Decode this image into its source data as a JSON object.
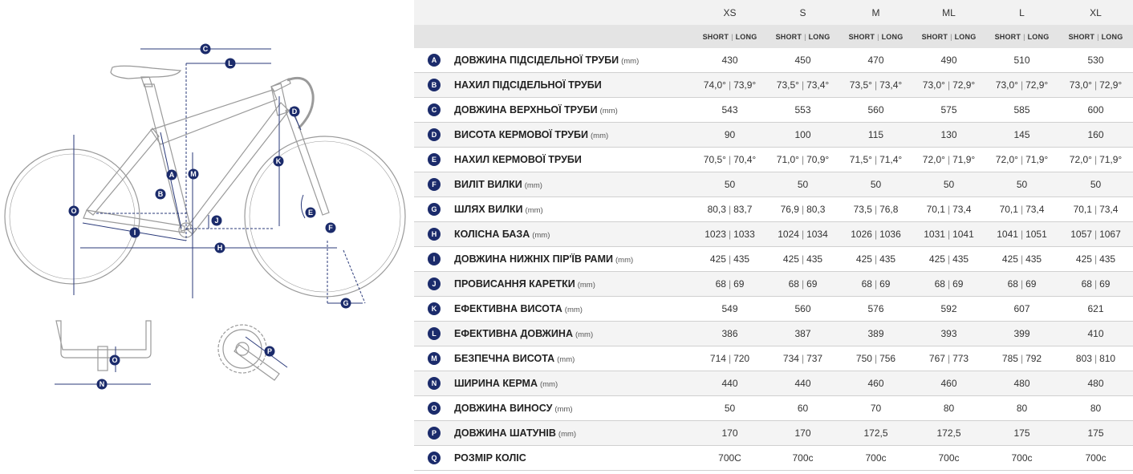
{
  "sizes": [
    {
      "name": "XS",
      "short": "SHORT",
      "long": "LONG"
    },
    {
      "name": "S",
      "short": "SHORT",
      "long": "LONG"
    },
    {
      "name": "M",
      "short": "SHORT",
      "long": "LONG"
    },
    {
      "name": "ML",
      "short": "SHORT",
      "long": "LONG"
    },
    {
      "name": "L",
      "short": "SHORT",
      "long": "LONG"
    },
    {
      "name": "XL",
      "short": "SHORT",
      "long": "LONG"
    }
  ],
  "separator": "|",
  "rows": [
    {
      "letter": "A",
      "name": "ДОВЖИНА ПІДСІДЕЛЬНОЇ ТРУБИ",
      "unit": "(mm)",
      "values": [
        [
          "430"
        ],
        [
          "450"
        ],
        [
          "470"
        ],
        [
          "490"
        ],
        [
          "510"
        ],
        [
          "530"
        ]
      ]
    },
    {
      "letter": "B",
      "name": "НАХИЛ ПІДСІДЕЛЬНОЇ ТРУБИ",
      "unit": "",
      "values": [
        [
          "74,0°",
          "73,9°"
        ],
        [
          "73,5°",
          "73,4°"
        ],
        [
          "73,5°",
          "73,4°"
        ],
        [
          "73,0°",
          "72,9°"
        ],
        [
          "73,0°",
          "72,9°"
        ],
        [
          "73,0°",
          "72,9°"
        ]
      ]
    },
    {
      "letter": "C",
      "name": "ДОВЖИНА ВЕРХНЬОЇ ТРУБИ",
      "unit": "(mm)",
      "values": [
        [
          "543"
        ],
        [
          "553"
        ],
        [
          "560"
        ],
        [
          "575"
        ],
        [
          "585"
        ],
        [
          "600"
        ]
      ]
    },
    {
      "letter": "D",
      "name": "ВИСОТА КЕРМОВОЇ ТРУБИ",
      "unit": "(mm)",
      "values": [
        [
          "90"
        ],
        [
          "100"
        ],
        [
          "115"
        ],
        [
          "130"
        ],
        [
          "145"
        ],
        [
          "160"
        ]
      ]
    },
    {
      "letter": "E",
      "name": "НАХИЛ КЕРМОВОЇ ТРУБИ",
      "unit": "",
      "values": [
        [
          "70,5°",
          "70,4°"
        ],
        [
          "71,0°",
          "70,9°"
        ],
        [
          "71,5°",
          "71,4°"
        ],
        [
          "72,0°",
          "71,9°"
        ],
        [
          "72,0°",
          "71,9°"
        ],
        [
          "72,0°",
          "71,9°"
        ]
      ]
    },
    {
      "letter": "F",
      "name": "ВИЛІТ ВИЛКИ",
      "unit": "(mm)",
      "values": [
        [
          "50"
        ],
        [
          "50"
        ],
        [
          "50"
        ],
        [
          "50"
        ],
        [
          "50"
        ],
        [
          "50"
        ]
      ]
    },
    {
      "letter": "G",
      "name": "ШЛЯХ ВИЛКИ",
      "unit": "(mm)",
      "values": [
        [
          "80,3",
          "83,7"
        ],
        [
          "76,9",
          "80,3"
        ],
        [
          "73,5",
          "76,8"
        ],
        [
          "70,1",
          "73,4"
        ],
        [
          "70,1",
          "73,4"
        ],
        [
          "70,1",
          "73,4"
        ]
      ]
    },
    {
      "letter": "H",
      "name": "КОЛІСНА БАЗА",
      "unit": "(mm)",
      "values": [
        [
          "1023",
          "1033"
        ],
        [
          "1024",
          "1034"
        ],
        [
          "1026",
          "1036"
        ],
        [
          "1031",
          "1041"
        ],
        [
          "1041",
          "1051"
        ],
        [
          "1057",
          "1067"
        ]
      ]
    },
    {
      "letter": "I",
      "name": "ДОВЖИНА НИЖНІХ ПІР'ЇВ РАМИ",
      "unit": "(mm)",
      "values": [
        [
          "425",
          "435"
        ],
        [
          "425",
          "435"
        ],
        [
          "425",
          "435"
        ],
        [
          "425",
          "435"
        ],
        [
          "425",
          "435"
        ],
        [
          "425",
          "435"
        ]
      ]
    },
    {
      "letter": "J",
      "name": "ПРОВИСАННЯ КАРЕТКИ",
      "unit": "(mm)",
      "values": [
        [
          "68",
          "69"
        ],
        [
          "68",
          "69"
        ],
        [
          "68",
          "69"
        ],
        [
          "68",
          "69"
        ],
        [
          "68",
          "69"
        ],
        [
          "68",
          "69"
        ]
      ]
    },
    {
      "letter": "K",
      "name": "ЕФЕКТИВНА ВИСОТА",
      "unit": "(mm)",
      "values": [
        [
          "549"
        ],
        [
          "560"
        ],
        [
          "576"
        ],
        [
          "592"
        ],
        [
          "607"
        ],
        [
          "621"
        ]
      ]
    },
    {
      "letter": "L",
      "name": "ЕФЕКТИВНА ДОВЖИНА",
      "unit": "(mm)",
      "values": [
        [
          "386"
        ],
        [
          "387"
        ],
        [
          "389"
        ],
        [
          "393"
        ],
        [
          "399"
        ],
        [
          "410"
        ]
      ]
    },
    {
      "letter": "M",
      "name": "БЕЗПЕЧНА ВИСОТА",
      "unit": "(mm)",
      "values": [
        [
          "714",
          "720"
        ],
        [
          "734",
          "737"
        ],
        [
          "750",
          "756"
        ],
        [
          "767",
          "773"
        ],
        [
          "785",
          "792"
        ],
        [
          "803",
          "810"
        ]
      ]
    },
    {
      "letter": "N",
      "name": "ШИРИНА КЕРМА",
      "unit": "(mm)",
      "values": [
        [
          "440"
        ],
        [
          "440"
        ],
        [
          "460"
        ],
        [
          "460"
        ],
        [
          "480"
        ],
        [
          "480"
        ]
      ]
    },
    {
      "letter": "O",
      "name": "ДОВЖИНА ВИНОСУ",
      "unit": "(mm)",
      "values": [
        [
          "50"
        ],
        [
          "60"
        ],
        [
          "70"
        ],
        [
          "80"
        ],
        [
          "80"
        ],
        [
          "80"
        ]
      ]
    },
    {
      "letter": "P",
      "name": "ДОВЖИНА ШАТУНІВ",
      "unit": "(mm)",
      "values": [
        [
          "170"
        ],
        [
          "170"
        ],
        [
          "172,5"
        ],
        [
          "172,5"
        ],
        [
          "175"
        ],
        [
          "175"
        ]
      ]
    },
    {
      "letter": "Q",
      "name": "РОЗМІР КОЛІС",
      "unit": "",
      "values": [
        [
          "700C"
        ],
        [
          "700c"
        ],
        [
          "700c"
        ],
        [
          "700c"
        ],
        [
          "700c"
        ],
        [
          "700c"
        ]
      ]
    }
  ],
  "diagram_labels": [
    "A",
    "B",
    "C",
    "D",
    "E",
    "F",
    "G",
    "H",
    "I",
    "J",
    "K",
    "L",
    "M",
    "N",
    "O",
    "O",
    "P"
  ],
  "colors": {
    "accent": "#1b2b6b",
    "line": "#2a3a7a",
    "frame": "#9a9a9a"
  }
}
